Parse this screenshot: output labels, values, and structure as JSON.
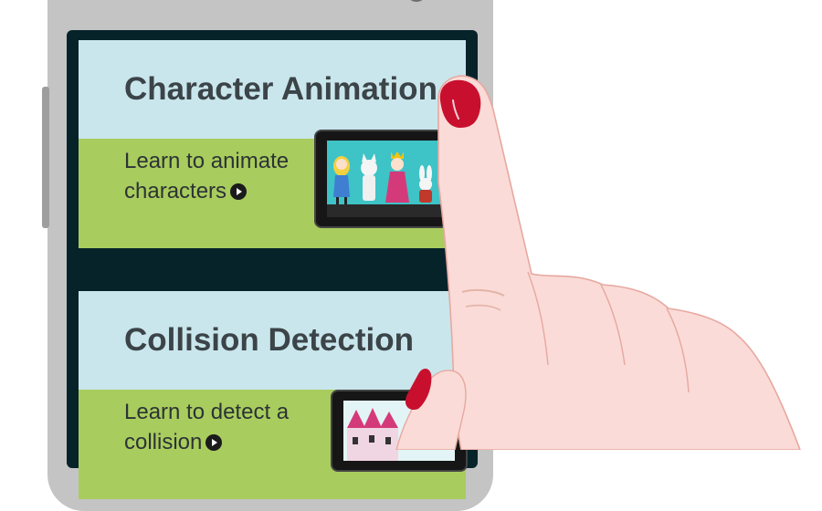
{
  "cards": [
    {
      "title": "Character Animation",
      "description": "Learn to animate characters",
      "action_icon": "play-circle-icon",
      "thumbnail_icon": "animated-characters-scene"
    },
    {
      "title": "Collision Detection",
      "description": "Learn to detect a collision",
      "action_icon": "play-circle-icon",
      "thumbnail_icon": "castle-scene"
    }
  ],
  "colors": {
    "screen_bg": "#06232a",
    "card_header": "#c9e6ec",
    "card_body": "#a9cc5e",
    "skin": "#fadbd7",
    "nail": "#c8102e"
  }
}
